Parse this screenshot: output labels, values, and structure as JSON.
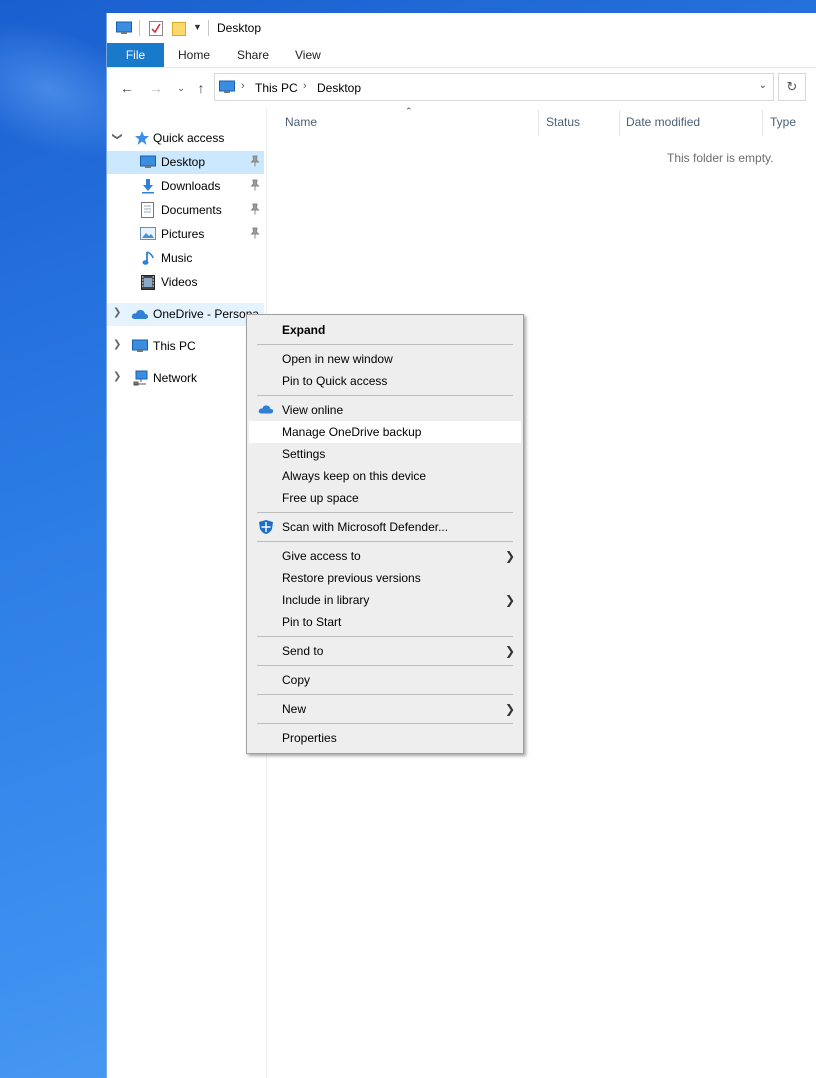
{
  "window": {
    "title": "Desktop"
  },
  "ribbon": {
    "tabs": [
      "File",
      "Home",
      "Share",
      "View"
    ]
  },
  "address": {
    "crumbs": [
      "This PC",
      "Desktop"
    ],
    "separator": "›"
  },
  "navpane": {
    "quick_access": "Quick access",
    "quick_items": [
      {
        "label": "Desktop",
        "icon": "desktop-icon",
        "pinned": true,
        "selected": true
      },
      {
        "label": "Downloads",
        "icon": "downloads-icon",
        "pinned": true
      },
      {
        "label": "Documents",
        "icon": "documents-icon",
        "pinned": true
      },
      {
        "label": "Pictures",
        "icon": "pictures-icon",
        "pinned": true
      },
      {
        "label": "Music",
        "icon": "music-icon",
        "pinned": false
      },
      {
        "label": "Videos",
        "icon": "videos-icon",
        "pinned": false
      }
    ],
    "onedrive": "OneDrive - Personal",
    "this_pc": "This PC",
    "network": "Network"
  },
  "content": {
    "columns": [
      "Name",
      "Status",
      "Date modified",
      "Type"
    ],
    "empty_message": "This folder is empty."
  },
  "context_menu": {
    "items": [
      {
        "label": "Expand",
        "bold": true
      },
      {
        "label": "Open in new window"
      },
      {
        "label": "Pin to Quick access"
      },
      {
        "label": "View online",
        "icon": "onedrive-cloud-icon"
      },
      {
        "label": "Manage OneDrive backup",
        "hover": true
      },
      {
        "label": "Settings"
      },
      {
        "label": "Always keep on this device"
      },
      {
        "label": "Free up space"
      },
      {
        "label": "Scan with Microsoft Defender...",
        "icon": "defender-shield-icon"
      },
      {
        "label": "Give access to",
        "submenu": true
      },
      {
        "label": "Restore previous versions"
      },
      {
        "label": "Include in library",
        "submenu": true
      },
      {
        "label": "Pin to Start"
      },
      {
        "label": "Send to",
        "submenu": true
      },
      {
        "label": "Copy"
      },
      {
        "label": "New",
        "submenu": true
      },
      {
        "label": "Properties"
      }
    ]
  },
  "colors": {
    "accent": "#1979ca",
    "selection": "#cce8ff",
    "menu_bg": "#eeeeee"
  }
}
